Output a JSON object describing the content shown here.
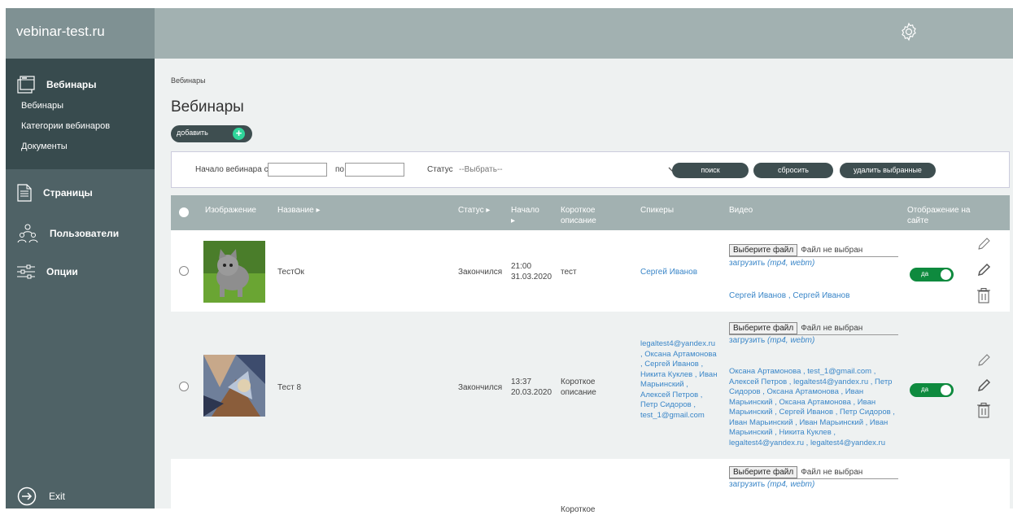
{
  "app": {
    "logo": "vebinar-test.ru"
  },
  "sidebar": {
    "webinars_head": "Вебинары",
    "sub": [
      "Вебинары",
      "Категории вебинаров",
      "Документы"
    ],
    "pages": "Страницы",
    "users": "Пользователи",
    "options": "Опции",
    "exit": "Exit"
  },
  "breadcrumb": "Вебинары",
  "title": "Вебинары",
  "add_label": "добавить",
  "filter": {
    "start_from": "Начало вебинара с",
    "to": "по",
    "status": "Статус",
    "select_placeholder": "--Выбрать--",
    "search": "поиск",
    "reset": "сбросить",
    "delete_selected": "удалить выбранные"
  },
  "columns": {
    "image": "Изображение",
    "name": "Название",
    "status": "Статус",
    "start": "Начало",
    "short_desc": "Короткое описание",
    "speakers": "Спикеры",
    "video": "Видео",
    "display": "Отображение на сайте"
  },
  "file_input": {
    "button": "Выберите файл",
    "none": "Файл не выбран",
    "upload": "загрузить",
    "formats": "(mp4, webm)"
  },
  "toggle_label": "да",
  "rows": [
    {
      "name": "ТестОк",
      "status": "Закончился",
      "time": "21:00",
      "date": "31.03.2020",
      "desc": "тест",
      "speakers": "Сергей Иванов",
      "video_speakers": "Сергей Иванов , Сергей Иванов"
    },
    {
      "name": "Тест 8",
      "status": "Закончился",
      "time": "13:37",
      "date": "20.03.2020",
      "desc": "Короткое описание",
      "speakers": "legaltest4@yandex.ru , Оксана Артамонова , Сергей Иванов , Никита Куклев , Иван Марьинский , Алексей Петров , Петр Сидоров , test_1@gmail.com",
      "video_speakers": "Оксана Артамонова , test_1@gmail.com , Алексей Петров , legaltest4@yandex.ru , Петр Сидоров , Оксана Артамонова , Иван Марьинский , Оксана Артамонова , Иван Марьинский , Сергей Иванов , Петр Сидоров , Иван Марьинский , Иван Марьинский , Иван Марьинский , Никита Куклев , legaltest4@yandex.ru , legaltest4@yandex.ru"
    },
    {
      "desc": "Короткое"
    }
  ]
}
